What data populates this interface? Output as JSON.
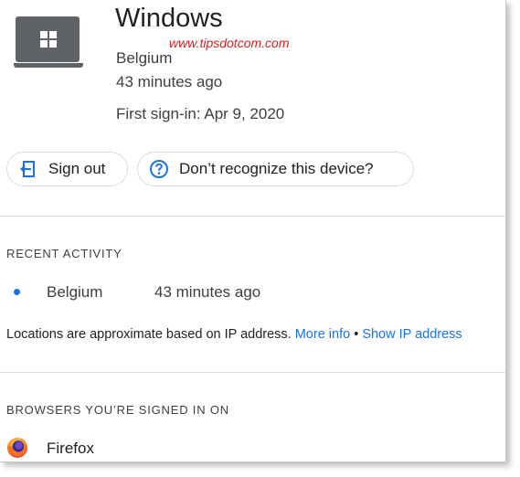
{
  "device": {
    "name": "Windows",
    "location": "Belgium",
    "last_seen": "43 minutes ago",
    "first_signin": "First sign-in: Apr 9, 2020",
    "icon": "windows-laptop-icon"
  },
  "watermark": "www.tipsdotcom.com",
  "buttons": {
    "sign_out": "Sign out",
    "not_recognized": "Don’t recognize this device?"
  },
  "recent_activity": {
    "heading": "RECENT ACTIVITY",
    "items": [
      {
        "location": "Belgium",
        "time": "43 minutes ago"
      }
    ],
    "note": "Locations are approximate based on IP address.",
    "more_info": "More info",
    "separator": "•",
    "show_ip": "Show IP address"
  },
  "browsers": {
    "heading": "BROWSERS YOU’RE SIGNED IN ON",
    "items": [
      {
        "name": "Firefox",
        "icon": "firefox-icon"
      }
    ]
  },
  "colors": {
    "accent": "#1a73e8",
    "watermark": "#d52020",
    "device_icon": "#5f6368"
  }
}
